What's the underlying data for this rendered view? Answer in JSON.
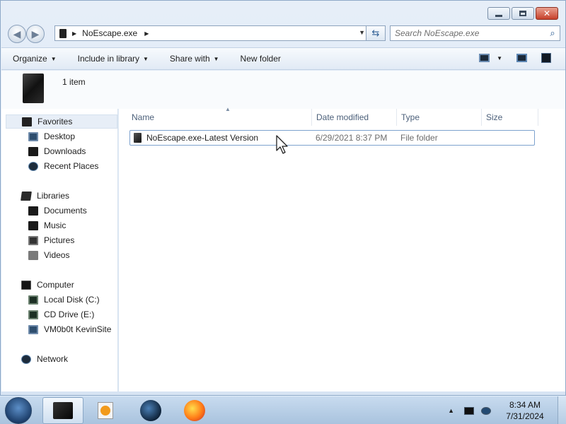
{
  "window": {
    "address": {
      "segment": "NoEscape.exe"
    },
    "search": {
      "placeholder": "Search NoEscape.exe"
    },
    "toolbar": {
      "organize": "Organize",
      "include_in_library": "Include in library",
      "share_with": "Share with",
      "new_folder": "New folder"
    },
    "info": {
      "item_count": "1 item"
    },
    "nav_pane": {
      "favorites": "Favorites",
      "favorites_items": [
        "Desktop",
        "Downloads",
        "Recent Places"
      ],
      "libraries": "Libraries",
      "libraries_items": [
        "Documents",
        "Music",
        "Pictures",
        "Videos"
      ],
      "computer": "Computer",
      "computer_items": [
        "Local Disk (C:)",
        "CD Drive (E:)",
        "VM0b0t KevinSite"
      ],
      "network": "Network"
    },
    "columns": {
      "name": "Name",
      "date": "Date modified",
      "type": "Type",
      "size": "Size"
    },
    "rows": [
      {
        "name": "NoEscape.exe-Latest Version",
        "date": "6/29/2021 8:37 PM",
        "type": "File folder",
        "size": ""
      }
    ]
  },
  "taskbar": {
    "clock_time": "8:34 AM",
    "clock_date": "7/31/2024"
  }
}
